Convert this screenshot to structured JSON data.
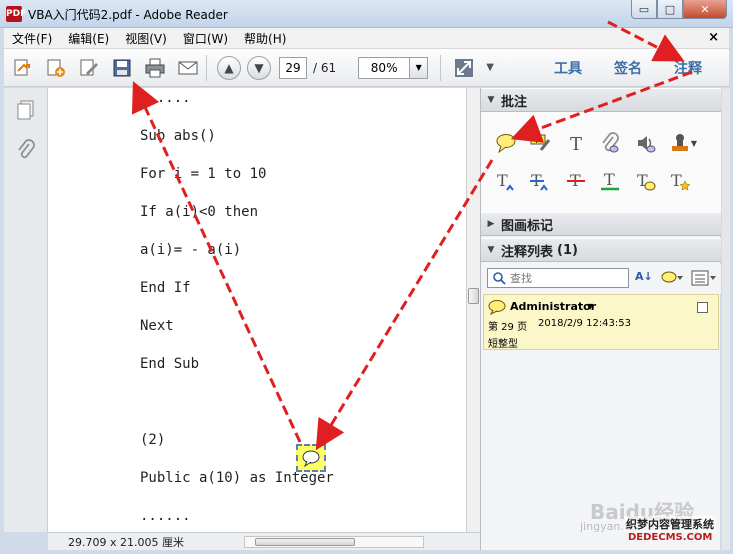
{
  "window": {
    "title": "VBA入门代码2.pdf - Adobe Reader",
    "min_glyph": "▭",
    "max_glyph": "□",
    "close_glyph": "✕"
  },
  "menu": {
    "items": [
      "文件(F)",
      "编辑(E)",
      "视图(V)",
      "窗口(W)",
      "帮助(H)"
    ],
    "doc_close": "×"
  },
  "toolbar": {
    "page_current": "29",
    "page_total": "/ 61",
    "zoom": "80%",
    "tabs": [
      "工具",
      "签名",
      "注释"
    ]
  },
  "document": {
    "lines": [
      "......",
      "Sub abs()",
      "For i = 1 to 10",
      "If a(i)<0 then",
      "a(i)= - a(i)",
      "End If",
      "Next",
      "End Sub",
      "",
      "(2)",
      "Public a(10) as Integer",
      "......"
    ]
  },
  "status": {
    "dimensions": "29.709 x 21.005 厘米"
  },
  "rightpane": {
    "annotations_header": "批注",
    "drawing_header": "图画标记",
    "list_header": "注释列表",
    "list_count": "(1)",
    "search_placeholder": "查找",
    "comment": {
      "author": "Administrator",
      "page": "第 29 页",
      "date": "2018/2/9 12:43:53",
      "text": "短整型"
    }
  },
  "watermark": {
    "brand": "Baidu经验",
    "url": "jingyan.baidu",
    "site_name": "织梦内容管理系统",
    "site_url": "DEDECMS.COM"
  },
  "colors": {
    "accent_blue": "#3f6fa6",
    "arrow_red": "#e02020",
    "note_yellow": "#ffff66"
  }
}
